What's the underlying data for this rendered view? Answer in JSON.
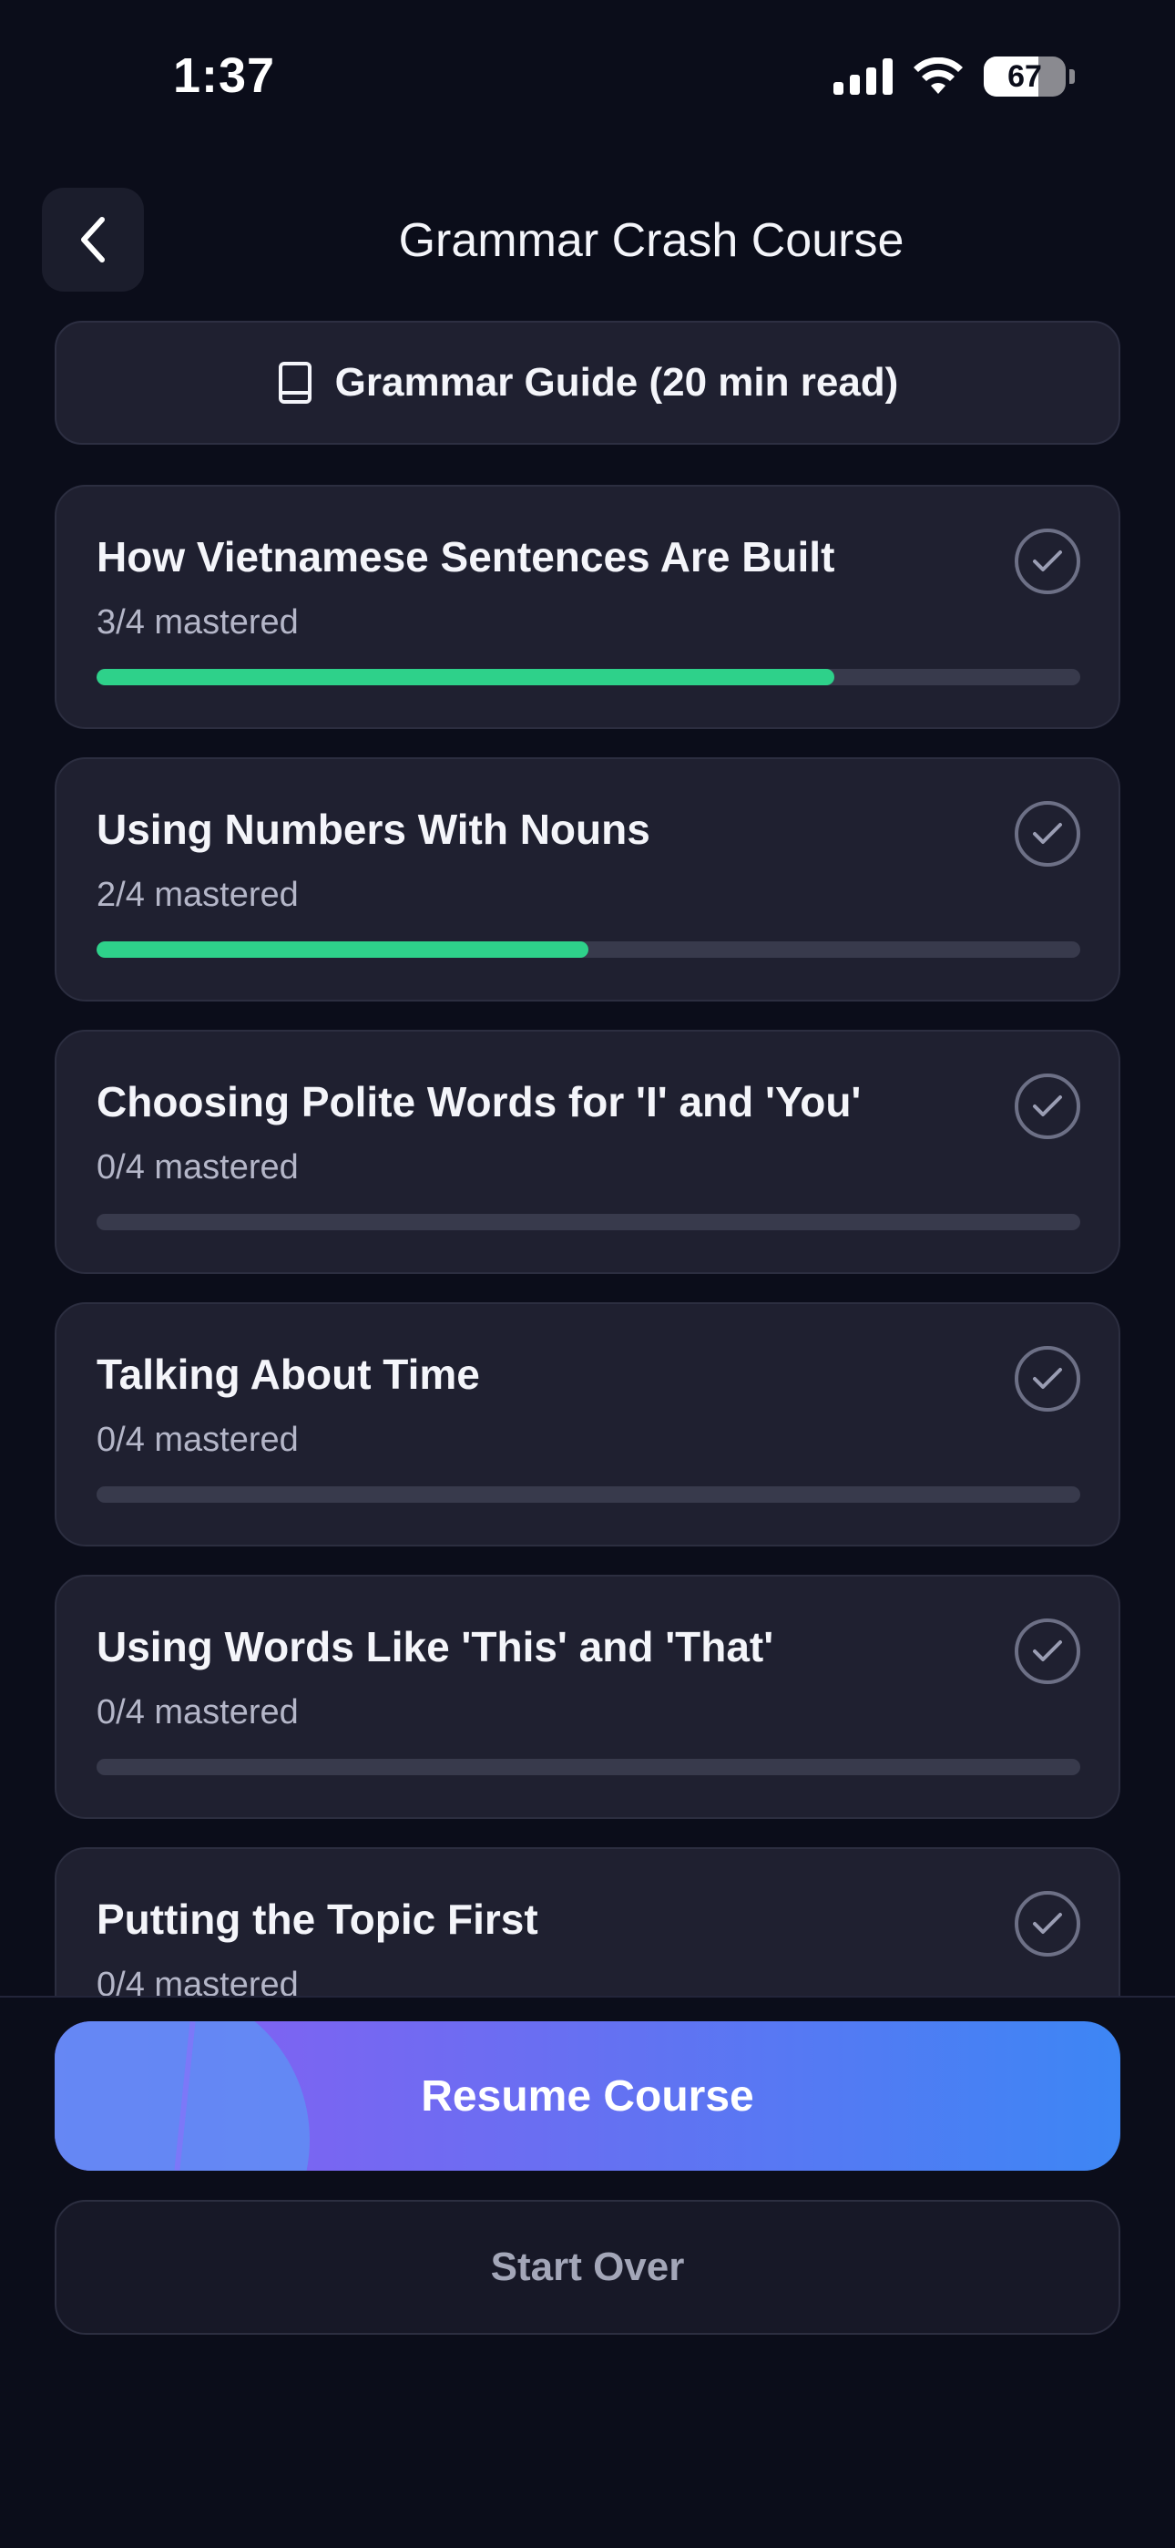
{
  "status_bar": {
    "time": "1:37",
    "battery_level": "67",
    "icons": [
      "signal-icon",
      "wifi-icon",
      "battery-icon"
    ]
  },
  "header": {
    "title": "Grammar Crash Course",
    "back_icon": "chevron-left-icon"
  },
  "guide": {
    "label": "Grammar Guide (20 min read)",
    "icon": "book-icon"
  },
  "lessons": [
    {
      "title": "How Vietnamese Sentences Are Built",
      "progress_text": "3/4 mastered",
      "progress": 0.75
    },
    {
      "title": "Using Numbers With Nouns",
      "progress_text": "2/4 mastered",
      "progress": 0.5
    },
    {
      "title": "Choosing Polite Words for 'I' and 'You'",
      "progress_text": "0/4 mastered",
      "progress": 0
    },
    {
      "title": "Talking About Time",
      "progress_text": "0/4 mastered",
      "progress": 0
    },
    {
      "title": "Using Words Like 'This' and 'That'",
      "progress_text": "0/4 mastered",
      "progress": 0
    },
    {
      "title": "Putting the Topic First",
      "progress_text": "0/4 mastered",
      "progress": 0
    }
  ],
  "actions": {
    "resume_label": "Resume Course",
    "start_over_label": "Start Over"
  },
  "colors": {
    "background": "#0b0d1a",
    "card": "#1f2030",
    "progress_fill": "#2ed18a",
    "progress_track": "#383a4c",
    "resume_gradient_start": "#8a5cf2",
    "resume_gradient_end": "#3d86f4"
  }
}
